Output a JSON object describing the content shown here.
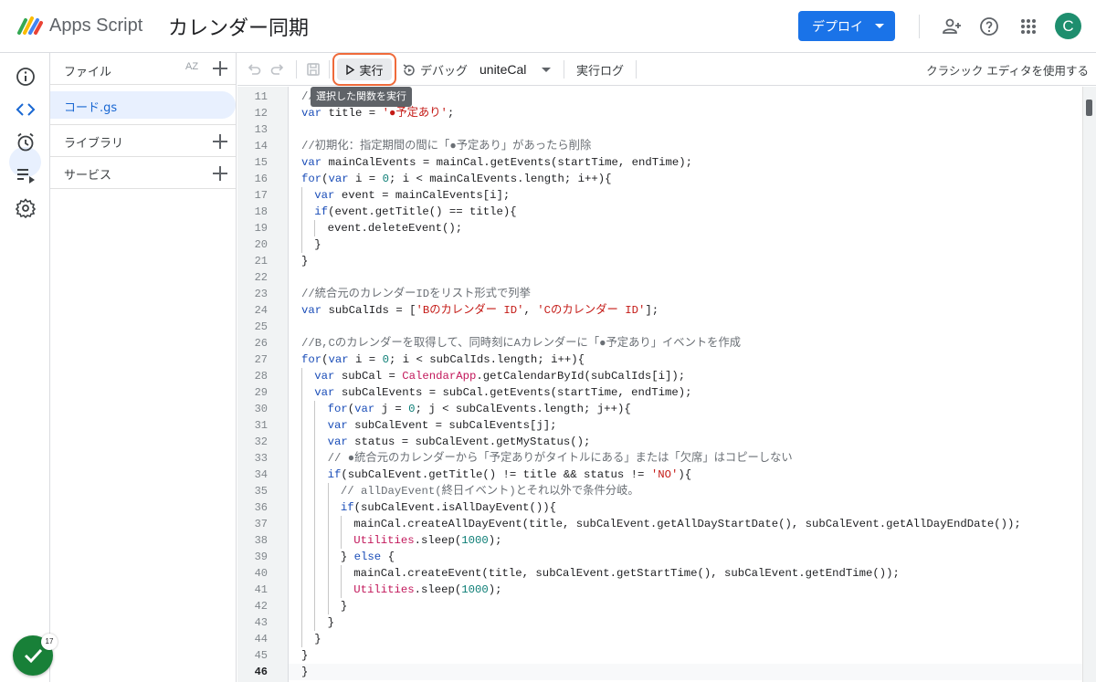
{
  "header": {
    "app_name": "Apps Script",
    "project_title": "カレンダー同期",
    "deploy_label": "デプロイ",
    "avatar_letter": "C",
    "icons": [
      "add-person-icon",
      "help-icon",
      "apps-grid-icon"
    ]
  },
  "rail": {
    "items": [
      "overview-icon",
      "editor-icon",
      "triggers-icon",
      "executions-icon",
      "settings-icon"
    ],
    "status_count": "17"
  },
  "files": {
    "title": "ファイル",
    "sort_label": "AZ",
    "items": [
      {
        "name": "コード.gs"
      }
    ],
    "sections": [
      {
        "label": "ライブラリ"
      },
      {
        "label": "サービス"
      }
    ]
  },
  "toolbar": {
    "run_label": "実行",
    "debug_label": "デバッグ",
    "function_name": "uniteCal",
    "exec_log_label": "実行ログ",
    "classic_label": "クラシック エディタを使用する",
    "tooltip": "選択した関数を実行"
  },
  "colors": {
    "accent": "#1a73e8",
    "highlight": "#ef6a3a",
    "avatar": "#1e8e6e",
    "status": "#188038"
  },
  "editor": {
    "current_line": 46,
    "lines": [
      {
        "n": 11,
        "indent": 0,
        "tokens": [
          {
            "t": "//",
            "c": "cm"
          }
        ]
      },
      {
        "n": 12,
        "indent": 0,
        "tokens": [
          {
            "t": "var",
            "c": "kw"
          },
          {
            "t": " title = "
          },
          {
            "t": "'●予定あり'",
            "c": "str"
          },
          {
            "t": ";"
          }
        ]
      },
      {
        "n": 13,
        "indent": 0,
        "tokens": []
      },
      {
        "n": 14,
        "indent": 0,
        "tokens": [
          {
            "t": "//初期化：指定期間の間に「●予定あり」があったら削除",
            "c": "cm"
          }
        ]
      },
      {
        "n": 15,
        "indent": 0,
        "tokens": [
          {
            "t": "var",
            "c": "kw"
          },
          {
            "t": " mainCalEvents = mainCal.getEvents(startTime, endTime);"
          }
        ]
      },
      {
        "n": 16,
        "indent": 0,
        "tokens": [
          {
            "t": "for",
            "c": "kw"
          },
          {
            "t": "("
          },
          {
            "t": "var",
            "c": "kw"
          },
          {
            "t": " i = "
          },
          {
            "t": "0",
            "c": "num"
          },
          {
            "t": "; i < mainCalEvents.length; i++){"
          }
        ]
      },
      {
        "n": 17,
        "indent": 1,
        "tokens": [
          {
            "t": "var",
            "c": "kw"
          },
          {
            "t": " event = mainCalEvents[i];"
          }
        ]
      },
      {
        "n": 18,
        "indent": 1,
        "tokens": [
          {
            "t": "if",
            "c": "kw"
          },
          {
            "t": "(event.getTitle() == title){"
          }
        ]
      },
      {
        "n": 19,
        "indent": 2,
        "tokens": [
          {
            "t": "event.deleteEvent();"
          }
        ]
      },
      {
        "n": 20,
        "indent": 1,
        "tokens": [
          {
            "t": "}"
          }
        ]
      },
      {
        "n": 21,
        "indent": 0,
        "tokens": [
          {
            "t": "}"
          }
        ]
      },
      {
        "n": 22,
        "indent": 0,
        "tokens": []
      },
      {
        "n": 23,
        "indent": 0,
        "tokens": [
          {
            "t": "//統合元のカレンダーIDをリスト形式で列挙",
            "c": "cm"
          }
        ]
      },
      {
        "n": 24,
        "indent": 0,
        "tokens": [
          {
            "t": "var",
            "c": "kw"
          },
          {
            "t": " subCalIds = ["
          },
          {
            "t": "'Bのカレンダー ID'",
            "c": "str"
          },
          {
            "t": ", "
          },
          {
            "t": "'Cのカレンダー ID'",
            "c": "str"
          },
          {
            "t": "];"
          }
        ]
      },
      {
        "n": 25,
        "indent": 0,
        "tokens": []
      },
      {
        "n": 26,
        "indent": 0,
        "tokens": [
          {
            "t": "//B,Cのカレンダーを取得して、同時刻にAカレンダーに「●予定あり」イベントを作成",
            "c": "cm"
          }
        ]
      },
      {
        "n": 27,
        "indent": 0,
        "tokens": [
          {
            "t": "for",
            "c": "kw"
          },
          {
            "t": "("
          },
          {
            "t": "var",
            "c": "kw"
          },
          {
            "t": " i = "
          },
          {
            "t": "0",
            "c": "num"
          },
          {
            "t": "; i < subCalIds.length; i++){"
          }
        ]
      },
      {
        "n": 28,
        "indent": 1,
        "tokens": [
          {
            "t": "var",
            "c": "kw"
          },
          {
            "t": " subCal = "
          },
          {
            "t": "CalendarApp",
            "c": "cls"
          },
          {
            "t": ".getCalendarById(subCalIds[i]);"
          }
        ]
      },
      {
        "n": 29,
        "indent": 1,
        "tokens": [
          {
            "t": "var",
            "c": "kw"
          },
          {
            "t": " subCalEvents = subCal.getEvents(startTime, endTime);"
          }
        ]
      },
      {
        "n": 30,
        "indent": 2,
        "tokens": [
          {
            "t": "for",
            "c": "kw"
          },
          {
            "t": "("
          },
          {
            "t": "var",
            "c": "kw"
          },
          {
            "t": " j = "
          },
          {
            "t": "0",
            "c": "num"
          },
          {
            "t": "; j < subCalEvents.length; j++){"
          }
        ]
      },
      {
        "n": 31,
        "indent": 2,
        "tokens": [
          {
            "t": "var",
            "c": "kw"
          },
          {
            "t": " subCalEvent = subCalEvents[j];"
          }
        ]
      },
      {
        "n": 32,
        "indent": 2,
        "tokens": [
          {
            "t": "var",
            "c": "kw"
          },
          {
            "t": " status = subCalEvent.getMyStatus();"
          }
        ]
      },
      {
        "n": 33,
        "indent": 2,
        "tokens": [
          {
            "t": "// ●統合元のカレンダーから「予定ありがタイトルにある」または「欠席」はコピーしない",
            "c": "cm"
          }
        ]
      },
      {
        "n": 34,
        "indent": 2,
        "tokens": [
          {
            "t": "if",
            "c": "kw"
          },
          {
            "t": "(subCalEvent.getTitle() != title && status != "
          },
          {
            "t": "'NO'",
            "c": "str"
          },
          {
            "t": "){"
          }
        ]
      },
      {
        "n": 35,
        "indent": 3,
        "tokens": [
          {
            "t": "// allDayEvent(終日イベント)とそれ以外で条件分岐。",
            "c": "cm"
          }
        ]
      },
      {
        "n": 36,
        "indent": 3,
        "tokens": [
          {
            "t": "if",
            "c": "kw"
          },
          {
            "t": "(subCalEvent.isAllDayEvent()){"
          }
        ]
      },
      {
        "n": 37,
        "indent": 4,
        "tokens": [
          {
            "t": "mainCal.createAllDayEvent(title, subCalEvent.getAllDayStartDate(), subCalEvent.getAllDayEndDate());"
          }
        ]
      },
      {
        "n": 38,
        "indent": 4,
        "tokens": [
          {
            "t": "Utilities",
            "c": "cls"
          },
          {
            "t": ".sleep("
          },
          {
            "t": "1000",
            "c": "num"
          },
          {
            "t": ");"
          }
        ]
      },
      {
        "n": 39,
        "indent": 3,
        "tokens": [
          {
            "t": "} "
          },
          {
            "t": "else",
            "c": "kw"
          },
          {
            "t": " {"
          }
        ]
      },
      {
        "n": 40,
        "indent": 4,
        "tokens": [
          {
            "t": "mainCal.createEvent(title, subCalEvent.getStartTime(), subCalEvent.getEndTime());"
          }
        ]
      },
      {
        "n": 41,
        "indent": 4,
        "tokens": [
          {
            "t": "Utilities",
            "c": "cls"
          },
          {
            "t": ".sleep("
          },
          {
            "t": "1000",
            "c": "num"
          },
          {
            "t": ");"
          }
        ]
      },
      {
        "n": 42,
        "indent": 3,
        "tokens": [
          {
            "t": "}"
          }
        ]
      },
      {
        "n": 43,
        "indent": 2,
        "tokens": [
          {
            "t": "}"
          }
        ]
      },
      {
        "n": 44,
        "indent": 1,
        "tokens": [
          {
            "t": "}"
          }
        ]
      },
      {
        "n": 45,
        "indent": 0,
        "tokens": [
          {
            "t": "}"
          }
        ]
      },
      {
        "n": 46,
        "indent": 0,
        "tokens": [
          {
            "t": "}"
          }
        ]
      }
    ]
  }
}
